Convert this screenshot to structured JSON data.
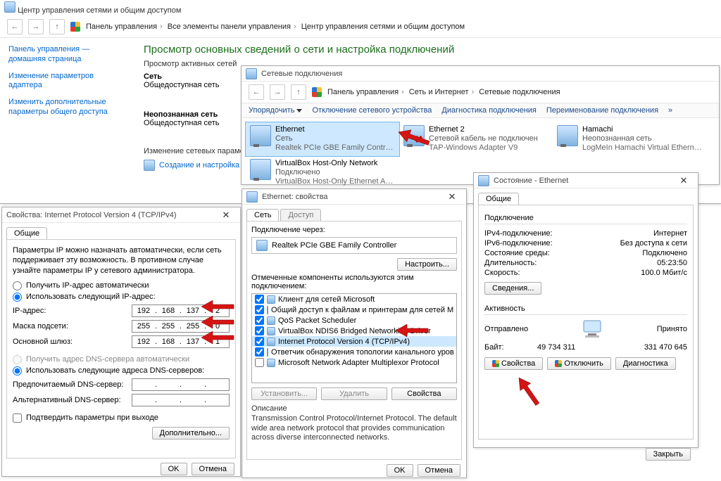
{
  "nc": {
    "title": "Центр управления сетями и общим доступом",
    "breadcrumbs": [
      "Панель управления",
      "Все элементы панели управления",
      "Центр управления сетями и общим доступом"
    ],
    "side": {
      "home": "Панель управления — домашняя страница",
      "adapter": "Изменение параметров адаптера",
      "sharing": "Изменить дополнительные параметры общего доступа"
    },
    "h1": "Просмотр основных сведений о сети и настройка подключений",
    "active_label": "Просмотр активных сетей",
    "net_name": "Сеть",
    "net_type": "Общедоступная сеть",
    "unk_name": "Неопознанная сеть",
    "unk_type": "Общедоступная сеть",
    "change_label": "Изменение сетевых параметров",
    "setup_label": "Создание и настройка"
  },
  "conns": {
    "title": "Сетевые подключения",
    "breadcrumbs": [
      "Панель управления",
      "Сеть и Интернет",
      "Сетевые подключения"
    ],
    "toolbar": {
      "organize": "Упорядочить",
      "disable": "Отключение сетевого устройства",
      "diag": "Диагностика подключения",
      "rename": "Переименование подключения"
    },
    "items": [
      {
        "name": "Ethernet",
        "line2": "Сеть",
        "line3": "Realtek PCIe GBE Family Controller"
      },
      {
        "name": "Ethernet 2",
        "line2": "Сетевой кабель не подключен",
        "line3": "TAP-Windows Adapter V9"
      },
      {
        "name": "Hamachi",
        "line2": "Неопознанная сеть",
        "line3": "LogMeIn Hamachi Virtual Etherne..."
      },
      {
        "name": "VirtualBox Host-Only Network",
        "line2": "Подключено",
        "line3": "VirtualBox Host-Only Ethernet Ad..."
      }
    ]
  },
  "status": {
    "title": "Состояние - Ethernet",
    "tab": "Общие",
    "group_conn": "Подключение",
    "ipv4_label": "IPv4-подключение:",
    "ipv4_val": "Интернет",
    "ipv6_label": "IPv6-подключение:",
    "ipv6_val": "Без доступа к сети",
    "media_label": "Состояние среды:",
    "media_val": "Подключено",
    "dur_label": "Длительность:",
    "dur_val": "05:23:50",
    "speed_label": "Скорость:",
    "speed_val": "100.0 Мбит/с",
    "details_btn": "Сведения...",
    "group_act": "Активность",
    "sent": "Отправлено",
    "recv": "Принято",
    "bytes_label": "Байт:",
    "bytes_sent": "49 734 311",
    "bytes_recv": "331 470 645",
    "props_btn": "Свойства",
    "disable_btn": "Отключить",
    "diag_btn": "Диагностика",
    "close_btn": "Закрыть"
  },
  "eprop": {
    "title": "Ethernet: свойства",
    "tab_net": "Сеть",
    "tab_access": "Доступ",
    "connect_via": "Подключение через:",
    "adapter": "Realtek PCIe GBE Family Controller",
    "config_btn": "Настроить...",
    "checked_label": "Отмеченные компоненты используются этим подключением:",
    "components": [
      "Клиент для сетей Microsoft",
      "Общий доступ к файлам и принтерам для сетей M",
      "QoS Packet Scheduler",
      "VirtualBox NDIS6 Bridged Networking Driver",
      "Internet Protocol Version 4 (TCP/IPv4)",
      "Ответчик обнаружения топологии канального уров",
      "Microsoft Network Adapter Multiplexor Protocol"
    ],
    "install_btn": "Установить...",
    "remove_btn": "Удалить",
    "props_btn": "Свойства",
    "desc_label": "Описание",
    "desc": "Transmission Control Protocol/Internet Protocol. The default wide area network protocol that provides communication across diverse interconnected networks.",
    "ok": "OK",
    "cancel": "Отмена"
  },
  "ipv4": {
    "title": "Свойства: Internet Protocol Version 4 (TCP/IPv4)",
    "tab": "Общие",
    "intro": "Параметры IP можно назначать автоматически, если сеть поддерживает эту возможность. В противном случае узнайте параметры IP у сетевого администратора.",
    "radio_auto_ip": "Получить IP-адрес автоматически",
    "radio_use_ip": "Использовать следующий IP-адрес:",
    "ip_label": "IP-адрес:",
    "ip": [
      "192",
      "168",
      "137",
      "2"
    ],
    "mask_label": "Маска подсети:",
    "mask": [
      "255",
      "255",
      "255",
      "0"
    ],
    "gw_label": "Основной шлюз:",
    "gw": [
      "192",
      "168",
      "137",
      "1"
    ],
    "radio_auto_dns": "Получить адрес DNS-сервера автоматически",
    "radio_use_dns": "Использовать следующие адреса DNS-серверов:",
    "dns1_label": "Предпочитаемый DNS-сервер:",
    "dns2_label": "Альтернативный DNS-сервер:",
    "confirm_chk": "Подтвердить параметры при выходе",
    "adv_btn": "Дополнительно...",
    "ok": "OK",
    "cancel": "Отмена"
  }
}
